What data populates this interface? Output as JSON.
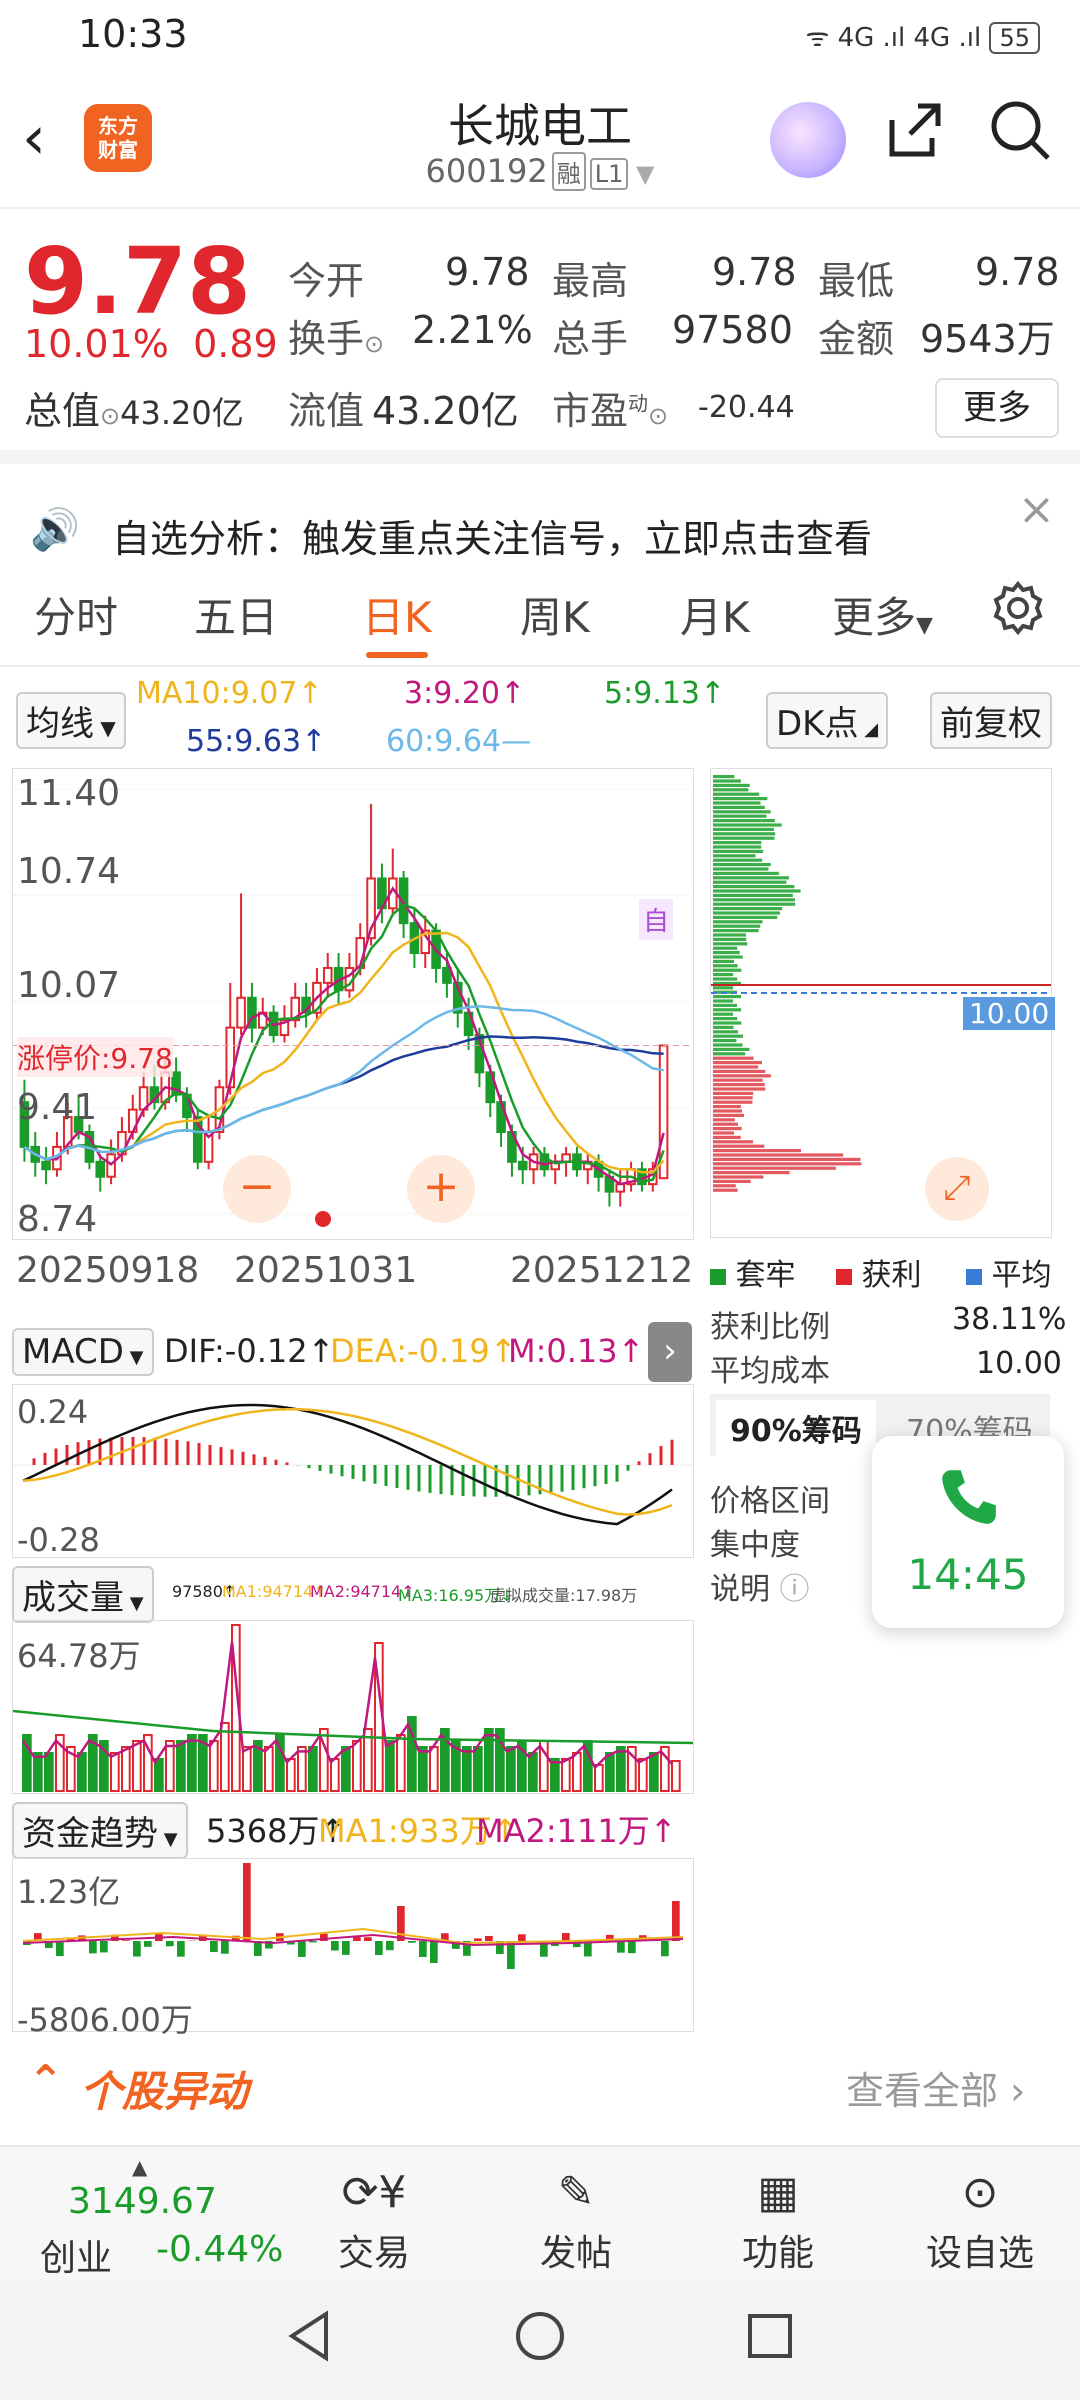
{
  "status": {
    "time": "10:33",
    "icons": "ᯤ 4G .ıl 4G .ıl",
    "battery": "55"
  },
  "header": {
    "logo": "东方\n财富",
    "name": "长城电工",
    "code": "600192",
    "tag1": "融",
    "tag2": "L1",
    "icons": [
      "robot-icon",
      "share-icon",
      "search-icon"
    ]
  },
  "quote": {
    "price": "9.78",
    "pct": "10.01%",
    "change": "0.89",
    "total_cap_label": "总值",
    "total_cap": "43.20亿",
    "open_label": "今开",
    "open": "9.78",
    "high_label": "最高",
    "high": "9.78",
    "low_label": "最低",
    "low": "9.78",
    "turnover_label": "换手",
    "turnover": "2.21%",
    "volume_label": "总手",
    "volume": "97580",
    "amount_label": "金额",
    "amount": "9543万",
    "float_cap_label": "流值",
    "float_cap": "43.20亿",
    "pe_label": "市盈",
    "pe_sup": "动",
    "pe": "-20.44",
    "more": "更多"
  },
  "notice": {
    "text": "自选分析：触发重点关注信号，立即点击查看"
  },
  "tabs": [
    "分时",
    "五日",
    "日K",
    "周K",
    "月K",
    "更多"
  ],
  "ma": {
    "chip": "均线",
    "ma10": "MA10:9.07↑",
    "ma3": "3:9.20↑",
    "ma5": "5:9.13↑",
    "ma55": "55:9.63↑",
    "ma60": "60:9.64—",
    "dk": "DK点",
    "fq": "前复权"
  },
  "kline": {
    "y_labels": [
      "11.40",
      "10.74",
      "10.07",
      "9.41",
      "8.74"
    ],
    "limit_label": "涨停价:9.78",
    "dates": [
      "20250918",
      "20251031",
      "20251212"
    ],
    "zoom_out": "−",
    "zoom_in": "+",
    "auto_badge": "自",
    "candles": [
      [
        9.4,
        9.1,
        9.55,
        9.0
      ],
      [
        9.1,
        9.0,
        9.2,
        8.9
      ],
      [
        9.0,
        8.95,
        9.1,
        8.85
      ],
      [
        8.95,
        9.1,
        9.2,
        8.9
      ],
      [
        9.1,
        9.3,
        9.4,
        9.05
      ],
      [
        9.3,
        9.2,
        9.45,
        9.15
      ],
      [
        9.2,
        9.0,
        9.25,
        8.95
      ],
      [
        9.0,
        8.9,
        9.05,
        8.8
      ],
      [
        8.9,
        9.05,
        9.15,
        8.85
      ],
      [
        9.05,
        9.2,
        9.3,
        9.0
      ],
      [
        9.2,
        9.35,
        9.45,
        9.15
      ],
      [
        9.35,
        9.5,
        9.6,
        9.3
      ],
      [
        9.5,
        9.4,
        9.65,
        9.35
      ],
      [
        9.4,
        9.6,
        9.7,
        9.35
      ],
      [
        9.6,
        9.45,
        9.7,
        9.4
      ],
      [
        9.45,
        9.3,
        9.5,
        9.2
      ],
      [
        9.3,
        9.0,
        9.35,
        8.95
      ],
      [
        9.0,
        9.2,
        9.3,
        8.95
      ],
      [
        9.2,
        9.5,
        9.55,
        9.15
      ],
      [
        9.5,
        9.9,
        10.2,
        9.45
      ],
      [
        9.9,
        10.1,
        10.8,
        9.85
      ],
      [
        10.1,
        9.9,
        10.2,
        9.8
      ],
      [
        9.9,
        10.0,
        10.1,
        9.85
      ],
      [
        10.0,
        9.85,
        10.05,
        9.8
      ],
      [
        9.85,
        9.95,
        10.05,
        9.8
      ],
      [
        9.95,
        10.1,
        10.2,
        9.9
      ],
      [
        10.1,
        10.0,
        10.2,
        9.9
      ],
      [
        10.0,
        10.2,
        10.3,
        9.95
      ],
      [
        10.2,
        10.3,
        10.4,
        10.1
      ],
      [
        10.3,
        10.15,
        10.4,
        10.05
      ],
      [
        10.15,
        10.3,
        10.4,
        10.1
      ],
      [
        10.3,
        10.5,
        10.6,
        10.25
      ],
      [
        10.5,
        10.9,
        11.4,
        10.45
      ],
      [
        10.9,
        10.7,
        11.0,
        10.6
      ],
      [
        10.7,
        10.9,
        11.1,
        10.65
      ],
      [
        10.9,
        10.6,
        10.95,
        10.5
      ],
      [
        10.6,
        10.4,
        10.7,
        10.3
      ],
      [
        10.4,
        10.55,
        10.65,
        10.3
      ],
      [
        10.55,
        10.3,
        10.6,
        10.2
      ],
      [
        10.3,
        10.2,
        10.4,
        10.1
      ],
      [
        10.2,
        10.0,
        10.3,
        9.9
      ],
      [
        10.0,
        9.85,
        10.1,
        9.75
      ],
      [
        9.85,
        9.6,
        9.9,
        9.5
      ],
      [
        9.6,
        9.4,
        9.65,
        9.3
      ],
      [
        9.4,
        9.2,
        9.45,
        9.1
      ],
      [
        9.2,
        9.0,
        9.25,
        8.9
      ],
      [
        9.0,
        8.95,
        9.1,
        8.85
      ],
      [
        8.95,
        9.05,
        9.1,
        8.85
      ],
      [
        9.05,
        8.95,
        9.1,
        8.9
      ],
      [
        8.95,
        9.0,
        9.05,
        8.85
      ],
      [
        9.0,
        9.05,
        9.1,
        8.9
      ],
      [
        9.05,
        8.95,
        9.1,
        8.9
      ],
      [
        8.95,
        9.0,
        9.05,
        8.85
      ],
      [
        9.0,
        8.9,
        9.05,
        8.8
      ],
      [
        8.9,
        8.8,
        8.95,
        8.7
      ],
      [
        8.8,
        8.85,
        8.95,
        8.7
      ],
      [
        8.85,
        8.95,
        9.0,
        8.8
      ],
      [
        8.95,
        8.85,
        9.0,
        8.8
      ],
      [
        8.85,
        8.95,
        9.0,
        8.8
      ],
      [
        8.89,
        9.78,
        9.78,
        8.89
      ]
    ]
  },
  "chip_dist": {
    "avg_label": "10.00",
    "legend": [
      "套牢",
      "获利",
      "平均"
    ],
    "profit_ratio_label": "获利比例",
    "profit_ratio": "38.11%",
    "avg_cost_label": "平均成本",
    "avg_cost": "10.00",
    "tab90": "90%筹码",
    "tab70": "70%筹码",
    "range_label": "价格区间",
    "conc_label": "集中度",
    "desc_label": "说明"
  },
  "macd": {
    "chip": "MACD",
    "dif": "DIF:-0.12↑",
    "dea": "DEA:-0.19↑",
    "m": "M:0.13↑",
    "top": "0.24",
    "bottom": "-0.28"
  },
  "volume": {
    "chip": "成交量",
    "info": "97580↑",
    "ma1": "MA1:94714↑",
    "ma2": "MA2:94714↑",
    "ma3": "MA3:16.95万↓",
    "virt": "虚拟成交量:17.98万",
    "top": "64.78万"
  },
  "fund": {
    "chip": "资金趋势",
    "val": "5368万↑",
    "ma1": "MA1:933万↑",
    "ma2": "MA2:111万↑",
    "top": "1.23亿",
    "bottom": "-5806.00万"
  },
  "alert": {
    "title": "个股异动",
    "more": "查看全部"
  },
  "call": {
    "time": "14:45"
  },
  "bottom_nav": {
    "index_val": "3149.67",
    "index_name": "创业",
    "index_pct": "-0.44%",
    "items": [
      "交易",
      "发帖",
      "功能",
      "设自选"
    ]
  },
  "colors": {
    "red": "#e0272d",
    "green": "#1a9c2a",
    "orange": "#f06321",
    "blue": "#1f3b9c"
  }
}
